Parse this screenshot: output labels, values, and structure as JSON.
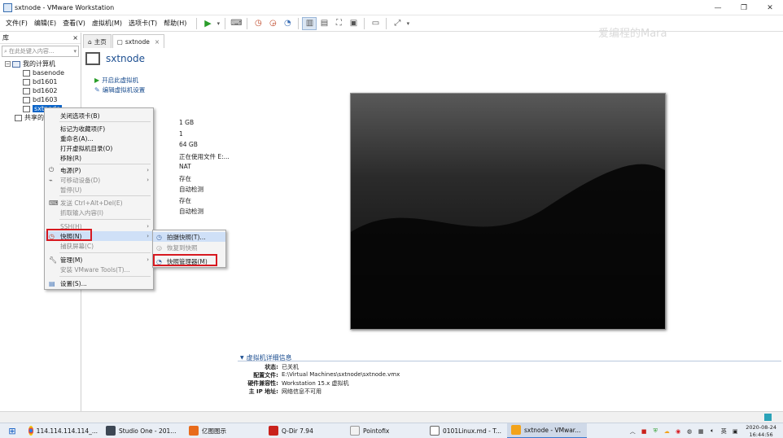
{
  "window": {
    "title": "sxtnode - VMware Workstation"
  },
  "menu": [
    "文件(F)",
    "编辑(E)",
    "查看(V)",
    "虚拟机(M)",
    "选项卡(T)",
    "帮助(H)"
  ],
  "library": {
    "title": "库",
    "close": "×",
    "search_placeholder": "在此处键入内容...",
    "tree": {
      "root": "我的计算机",
      "vms": [
        "basenode",
        "bd1601",
        "bd1602",
        "bd1603",
        "sxtnode"
      ],
      "shared": "共享的虚拟机"
    }
  },
  "tabs": [
    {
      "label": "主页"
    },
    {
      "label": "sxtnode",
      "close": "×"
    }
  ],
  "vm": {
    "name": "sxtnode",
    "power_on": "开启此虚拟机",
    "edit_settings": "编辑虚拟机设置"
  },
  "device_values": [
    "1 GB",
    "1",
    "64 GB",
    "正在使用文件 E:...",
    "NAT",
    "存在",
    "自动检测",
    "存在",
    "自动检测"
  ],
  "details": {
    "header": "虚拟机详细信息",
    "rows": [
      {
        "key": "状态:",
        "value": "已关机"
      },
      {
        "key": "配置文件:",
        "value": "E:\\Virtual Machines\\sxtnode\\sxtnode.vmx"
      },
      {
        "key": "硬件兼容性:",
        "value": "Workstation 15.x 虚拟机"
      },
      {
        "key": "主 IP 地址:",
        "value": "网络信息不可用"
      }
    ]
  },
  "context_menu": {
    "items": [
      "关闭选项卡(B)",
      "标记为收藏项(F)",
      "重命名(A)...",
      "打开虚拟机目录(O)",
      "移除(R)",
      "电源(P)",
      "可移动设备(D)",
      "暂停(U)",
      "发送 Ctrl+Alt+Del(E)",
      "抓取输入内容(I)",
      "SSH(H)",
      "快照(N)",
      "捕获屏幕(C)",
      "管理(M)",
      "安装 VMware Tools(T)...",
      "设置(S)..."
    ]
  },
  "snapshot_submenu": {
    "items": [
      "拍摄快照(T)...",
      "恢复到快照",
      "快照管理器(M)"
    ]
  },
  "watermark": "爱编程的Mara",
  "taskbar": {
    "tasks": [
      "114.114.114.114_...",
      "Studio One - 201...",
      "亿图图示",
      "Q-Dir 7.94",
      "Pointofix",
      "0101Linux.md - T...",
      "sxtnode - VMwar..."
    ],
    "ime": "英",
    "date": "2020-08-24",
    "time": "16:44:56"
  },
  "colors": {
    "accent": "#1d4f91",
    "highlight_red": "#d71920",
    "selection": "#0a64c8"
  }
}
